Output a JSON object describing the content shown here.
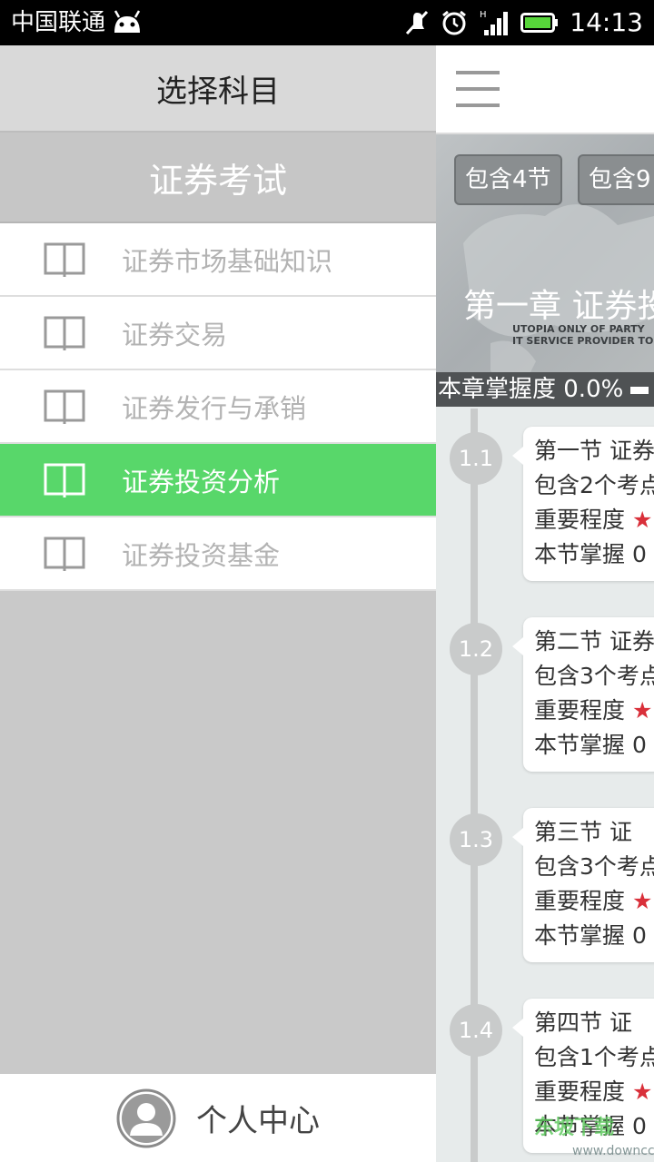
{
  "status_bar": {
    "carrier": "中国联通",
    "time": "14:13",
    "icons": [
      "android-icon",
      "mute-icon",
      "alarm-icon",
      "signal-icon",
      "battery-icon"
    ]
  },
  "drawer": {
    "title": "选择科目",
    "category": "证券考试",
    "items": [
      {
        "label": "证券市场基础知识",
        "active": false
      },
      {
        "label": "证券交易",
        "active": false
      },
      {
        "label": "证券发行与承销",
        "active": false
      },
      {
        "label": "证券投资分析",
        "active": true
      },
      {
        "label": "证券投资基金",
        "active": false
      }
    ],
    "footer_label": "个人中心"
  },
  "content": {
    "pills": [
      "包含4节",
      "包含9"
    ],
    "chapter_title": "第一章 证券投",
    "banner_text": {
      "line1": "UTOPIA ONLY OF PARTY",
      "line2": "IT SERVICE PROVIDER TO GLOBAL"
    },
    "progress_text": "本章掌握度  0.0%",
    "sections": [
      {
        "num": "1.1",
        "title": "第一节 证券",
        "points": "包含2个考点",
        "importance": "重要程度",
        "mastery": "本节掌握 0"
      },
      {
        "num": "1.2",
        "title": "第二节  证券",
        "points": "包含3个考点",
        "importance": "重要程度",
        "mastery": "本节掌握 0"
      },
      {
        "num": "1.3",
        "title": "第三节   证",
        "points": "包含3个考点",
        "importance": "重要程度",
        "mastery": "本节掌握 0"
      },
      {
        "num": "1.4",
        "title": "第四节   证",
        "points": "包含1个考点",
        "importance": "重要程度",
        "mastery": "本节掌握 0"
      }
    ],
    "watermark": "东坡下载",
    "watermark_url": "www.downcc.com"
  },
  "colors": {
    "accent_green": "#58d76a",
    "star_red": "#d9303a"
  }
}
